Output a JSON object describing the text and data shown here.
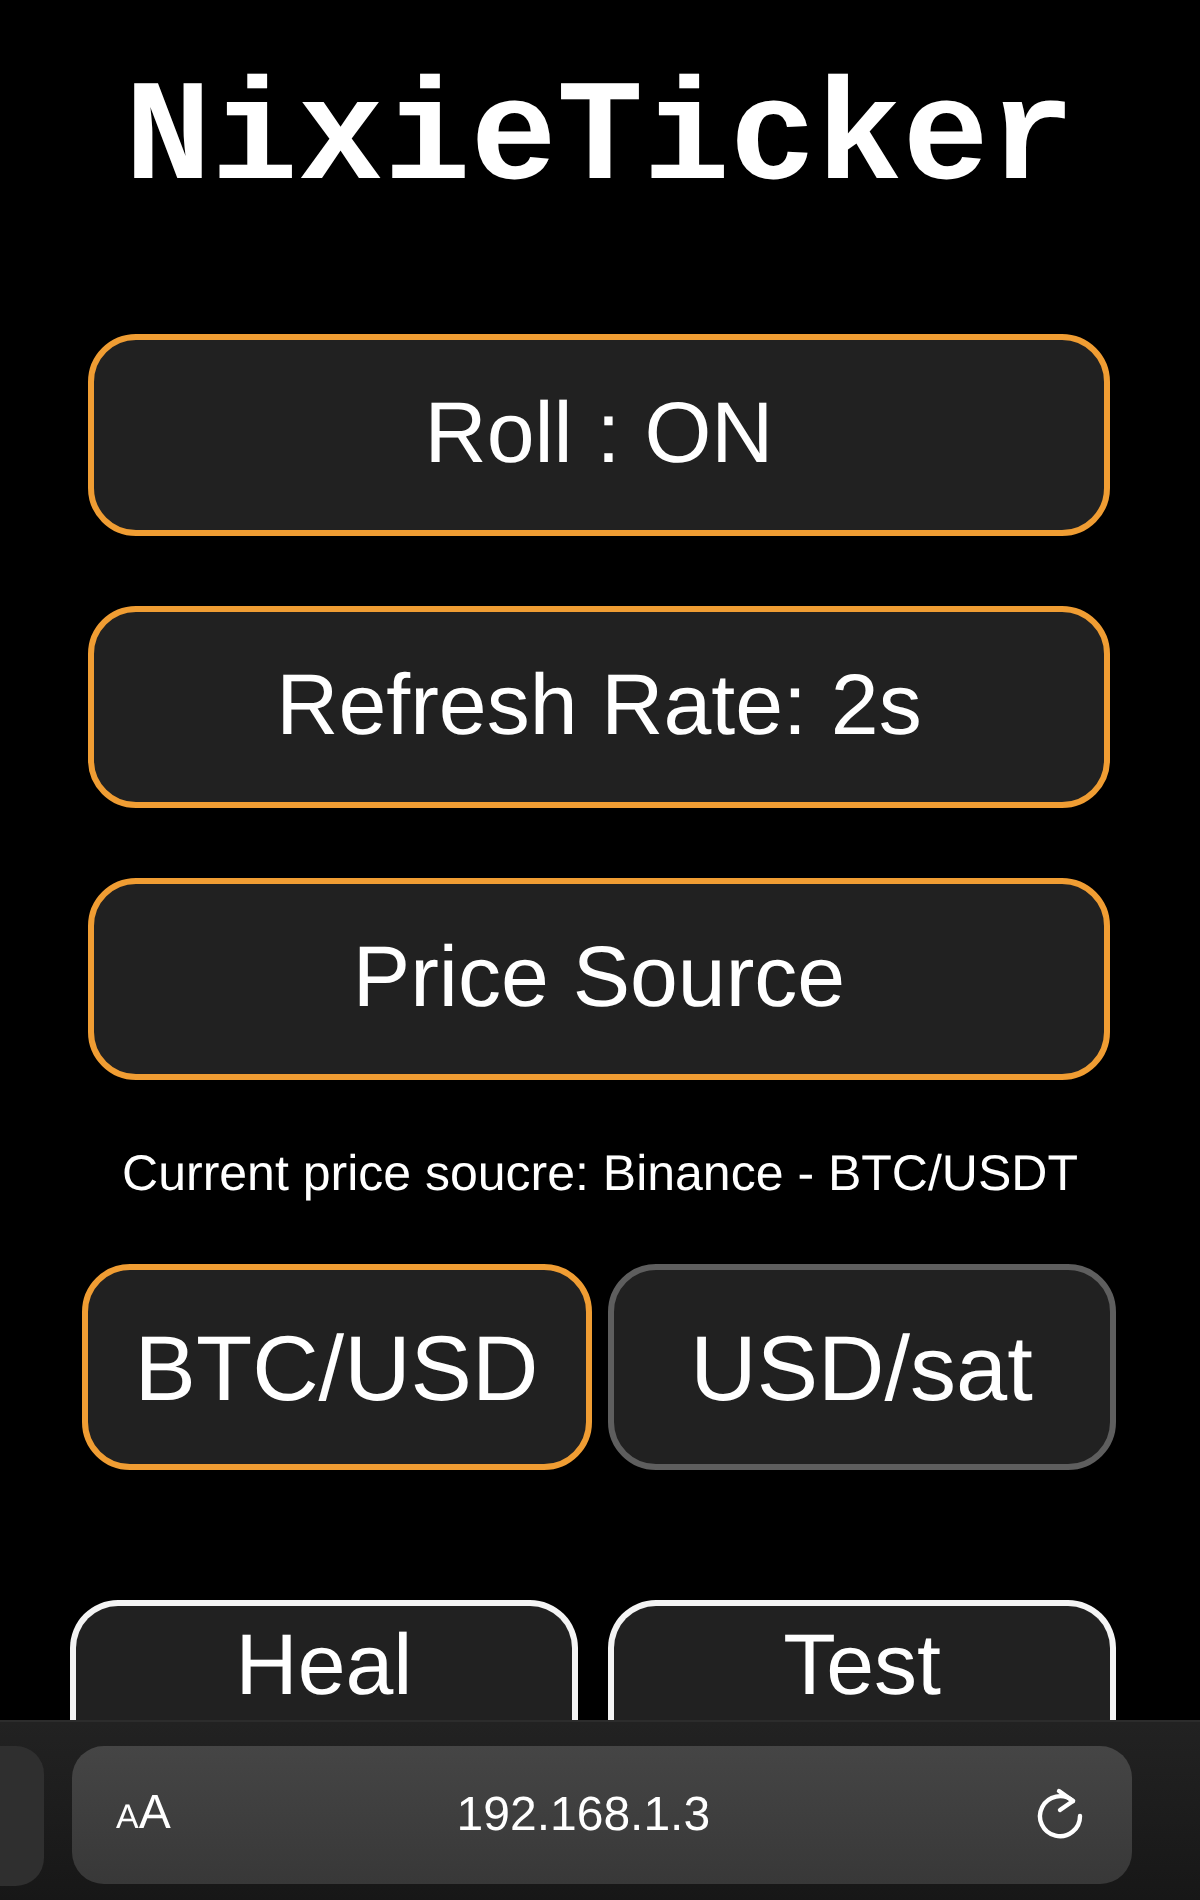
{
  "title": "NixieTicker",
  "menu_buttons": [
    {
      "label": "Roll : ON"
    },
    {
      "label": "Refresh Rate: 2s"
    },
    {
      "label": "Price Source"
    }
  ],
  "price_source_note": "Current price soucre: Binance - BTC/USDT",
  "units": [
    {
      "label": "BTC/USD",
      "selected": true
    },
    {
      "label": "USD/sat",
      "selected": false
    }
  ],
  "actions": [
    {
      "label": "Heal"
    },
    {
      "label": "Test"
    }
  ],
  "browser_bar": {
    "format_button": "AA",
    "url": "192.168.1.3"
  }
}
